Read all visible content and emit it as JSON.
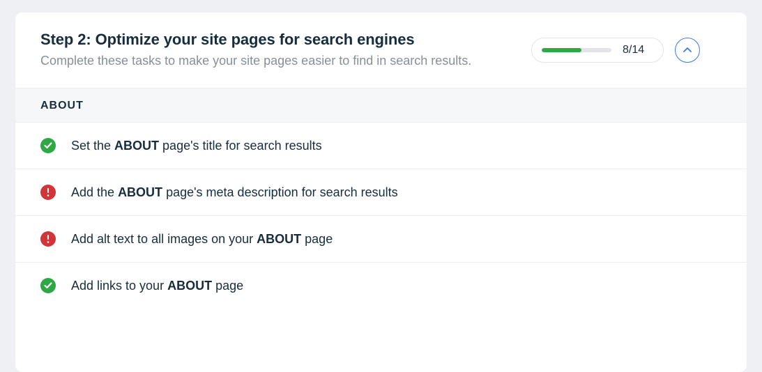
{
  "header": {
    "title": "Step 2: Optimize your site pages for search engines",
    "subtitle": "Complete these tasks to make your site pages easier to find in search results."
  },
  "progress": {
    "completed": 8,
    "total": 14,
    "label": "8/14",
    "percent": 57
  },
  "section": {
    "label": "ABOUT"
  },
  "tasks": [
    {
      "status": "done",
      "parts": [
        "Set the ",
        "ABOUT",
        " page's title for search results"
      ]
    },
    {
      "status": "warn",
      "parts": [
        "Add the ",
        "ABOUT",
        " page's meta description for search results"
      ]
    },
    {
      "status": "warn",
      "parts": [
        "Add alt text to all images on your ",
        "ABOUT",
        " page"
      ]
    },
    {
      "status": "done",
      "parts": [
        "Add links to your ",
        "ABOUT",
        " page"
      ]
    }
  ],
  "colors": {
    "success": "#2ea844",
    "error": "#d0353a",
    "accent": "#3a79e6"
  }
}
